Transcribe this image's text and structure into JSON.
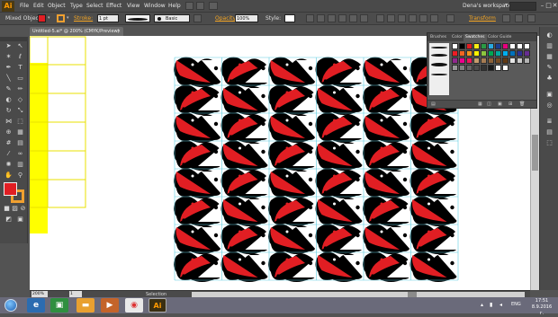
{
  "app": {
    "logo": "Ai",
    "menus": [
      "File",
      "Edit",
      "Object",
      "Type",
      "Select",
      "Effect",
      "View",
      "Window",
      "Help"
    ],
    "workspace": "Dena's workspace",
    "window_controls": [
      "–",
      "□",
      "✕"
    ]
  },
  "control_bar": {
    "object_label": "Mixed Objects",
    "fill_color": "#e11e23",
    "stroke_color": "#f0a030",
    "stroke_label": "Stroke:",
    "stroke_value": "1 pt",
    "basic_label": "Basic",
    "opacity_label": "Opacity:",
    "opacity_value": "100%",
    "style_label": "Style:",
    "transform_label": "Transform"
  },
  "document": {
    "tab_title": "Untitled-5.ai* @ 200% (CMYK/Preview)",
    "close": "✕"
  },
  "swatches_panel": {
    "tabs": [
      "Brushes",
      "Color",
      "Swatches",
      "Color Guide"
    ],
    "active_tab": "Swatches",
    "colors": [
      "#ffffff",
      "#000000",
      "#e11e23",
      "#f7ec13",
      "#2b9a45",
      "#29a9e0",
      "#1b3c8e",
      "#e5007d",
      "#ffffff",
      "#ffffff",
      "#ffffff",
      "#ed1c24",
      "#f26522",
      "#f7941d",
      "#fff200",
      "#8dc63f",
      "#00a651",
      "#00a99d",
      "#00aeef",
      "#0072bc",
      "#2e3192",
      "#662d91",
      "#92278f",
      "#ec008c",
      "#ed145b",
      "#c69c6d",
      "#a67c52",
      "#8c6239",
      "#754c24",
      "#603913",
      "#e6e6e6",
      "#cccccc",
      "#b3b3b3",
      "#999999",
      "#808080",
      "#666666",
      "#4d4d4d",
      "#333333",
      "#1a1a1a",
      "#f2f2f2",
      "#ffffff"
    ]
  },
  "status_bar": {
    "zoom": "200%",
    "page": "1",
    "tool": "Selection"
  },
  "taskbar": {
    "ai_label": "Ai",
    "lang": "ENG",
    "time": "17:51",
    "date": "8.9.2016 г."
  },
  "artwork": {
    "colors": {
      "red": "#e11e23",
      "black": "#000000",
      "white": "#ffffff",
      "yellow": "#ffff00",
      "guide": "#5ccce0",
      "grid": "#e8e000"
    }
  }
}
